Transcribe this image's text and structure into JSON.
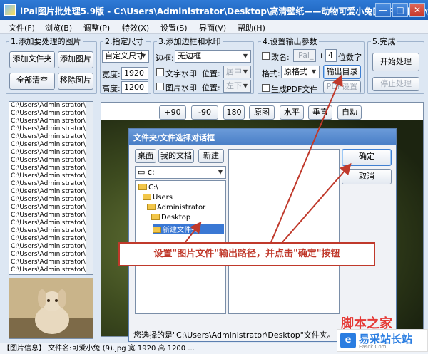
{
  "window": {
    "title": "iPai图片批处理5.9版 - C:\\Users\\Administrator\\Desktop\\高清壁纸——动物可爱小兔[40P]\\可爱小兔 (",
    "minimize": "—",
    "maximize": "□",
    "close": "✕"
  },
  "menu": [
    "文件(F)",
    "浏览(B)",
    "调整(P)",
    "特效(X)",
    "设置(S)",
    "界面(V)",
    "帮助(H)"
  ],
  "group1": {
    "legend": "1.添加要处理的图片",
    "add_folder": "添加文件夹",
    "add_image": "添加图片",
    "clear_all": "全部清空",
    "remove_image": "移除图片"
  },
  "group2": {
    "legend": "2.指定尺寸",
    "size_mode": "自定义尺寸",
    "width_label": "宽度:",
    "width_value": "1920",
    "height_label": "高度:",
    "height_value": "1200"
  },
  "group3": {
    "legend": "3.添加边框和水印",
    "border_label": "边框:",
    "border_value": "无边框",
    "text_watermark": "文字水印",
    "image_watermark": "图片水印",
    "position_label": "位置:",
    "text_position": "居中",
    "image_position": "左下"
  },
  "group4": {
    "legend": "4.设置输出参数",
    "rename_label": "改名:",
    "rename_value": "iPai_",
    "plus": "+",
    "digits_value": "4",
    "digits_label": "位数字",
    "format_label": "格式:",
    "format_value": "原格式",
    "output_dir": "输出目录",
    "make_pdf": "生成PDF文件",
    "pdf_settings": "PDF设置"
  },
  "group5": {
    "legend": "5.完成",
    "start": "开始处理",
    "stop": "停止处理"
  },
  "file_list": [
    "C:\\Users\\Administrator\\D",
    "C:\\Users\\Administrator\\D",
    "C:\\Users\\Administrator\\D",
    "C:\\Users\\Administrator\\D",
    "C:\\Users\\Administrator\\D",
    "C:\\Users\\Administrator\\D",
    "C:\\Users\\Administrator\\D",
    "C:\\Users\\Administrator\\D",
    "C:\\Users\\Administrator\\D",
    "C:\\Users\\Administrator\\D",
    "C:\\Users\\Administrator\\D",
    "C:\\Users\\Administrator\\D",
    "C:\\Users\\Administrator\\D",
    "C:\\Users\\Administrator\\D",
    "C:\\Users\\Administrator\\D",
    "C:\\Users\\Administrator\\D",
    "C:\\Users\\Administrator\\D",
    "C:\\Users\\Administrator\\D",
    "C:\\Users\\Administrator\\D",
    "C:\\Users\\Administrator\\D",
    "C:\\Users\\Administrator\\D",
    "C:\\Users\\Administrator\\D"
  ],
  "preview_toolbar": [
    "+90",
    "-90",
    "180",
    "原图",
    "水平",
    "垂直",
    "自动"
  ],
  "dialog": {
    "title": "文件夹/文件选择对话框",
    "desktop": "桌面",
    "my_docs": "我的文档",
    "new_folder": "新建",
    "drive": "c:",
    "tree": [
      "C:\\",
      "Users",
      "Administrator",
      "Desktop",
      "新建文件夹"
    ],
    "ok": "确定",
    "cancel": "取消",
    "selection": "您选择的是\"C:\\Users\\Administrator\\Desktop\"文件夹。"
  },
  "callout": "设置\"图片文件\"输出路径，并点击\"确定\"按钮",
  "statusbar": "【图片信息】 文件名:可爱小兔 (9).jpg  宽 1920 高 1200 ...",
  "watermark": {
    "site1": "脚本之家",
    "site2": "易采站长站",
    "site2_sub": "Easck.Com"
  },
  "colors": {
    "titlebar": "#1a5fb8",
    "callout": "#c0392b",
    "watermark1": "#e53935",
    "watermark2": "#2a7de1"
  }
}
